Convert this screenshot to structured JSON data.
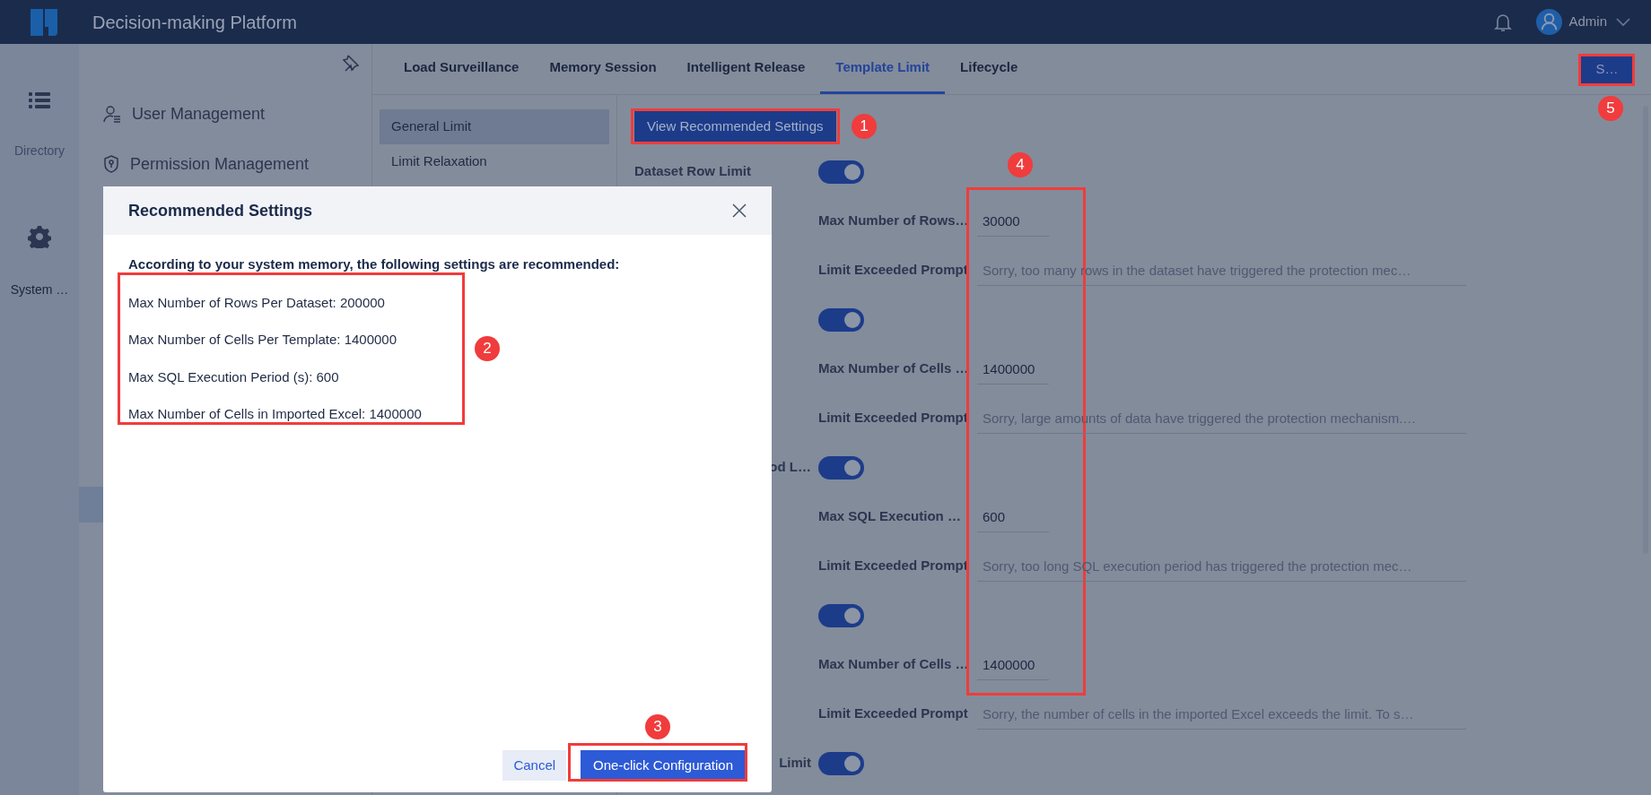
{
  "header": {
    "title": "Decision-making Platform",
    "user": "Admin"
  },
  "rail": [
    {
      "label": "Directory",
      "selected": false
    },
    {
      "label": "System …",
      "selected": true
    }
  ],
  "sidebar": {
    "items": [
      {
        "label": "User Management"
      },
      {
        "label": "Permission Management"
      }
    ]
  },
  "tabs": [
    {
      "label": "Load Surveillance",
      "selected": false
    },
    {
      "label": "Memory Session",
      "selected": false
    },
    {
      "label": "Intelligent Release",
      "selected": false
    },
    {
      "label": "Template Limit",
      "selected": true
    },
    {
      "label": "Lifecycle",
      "selected": false
    }
  ],
  "tab_action": {
    "label": "S…"
  },
  "subnav": [
    {
      "label": "General Limit",
      "selected": true
    },
    {
      "label": "Limit Relaxation",
      "selected": false
    }
  ],
  "view_button": {
    "label": "View Recommended Settings"
  },
  "limits": [
    {
      "label": "Dataset Row Limit",
      "on": true,
      "fields": [
        {
          "kind": "number",
          "label": "Max Number of Rows…",
          "value": "30000"
        },
        {
          "kind": "prompt",
          "label": "Limit Exceeded Prompt",
          "value": "Sorry, too many rows in the dataset have triggered the protection mec…"
        }
      ]
    },
    {
      "on": true,
      "fields": [
        {
          "kind": "number",
          "label": "Max Number of Cells …",
          "value": "1400000"
        },
        {
          "kind": "prompt",
          "label": "Limit Exceeded Prompt",
          "value": "Sorry, large amounts of data have triggered the protection mechanism.…"
        }
      ]
    },
    {
      "label": "od L…",
      "on": true,
      "fields": [
        {
          "kind": "number",
          "label": "Max SQL Execution …",
          "value": "600"
        },
        {
          "kind": "prompt",
          "label": "Limit Exceeded Prompt",
          "value": "Sorry, too long SQL execution period has triggered the protection mec…"
        }
      ]
    },
    {
      "on": true,
      "fields": [
        {
          "kind": "number",
          "label": "Max Number of Cells …",
          "value": "1400000"
        },
        {
          "kind": "prompt",
          "label": "Limit Exceeded Prompt",
          "value": "Sorry, the number of cells in the imported Excel exceeds the limit. To s…"
        }
      ]
    },
    {
      "label": "Limit",
      "on": true
    }
  ],
  "dialog": {
    "title": "Recommended Settings",
    "intro": "According to your system memory, the following settings are recommended:",
    "items": [
      "Max Number of Rows Per Dataset: 200000",
      "Max Number of Cells Per Template: 1400000",
      "Max SQL Execution Period (s): 600",
      "Max Number of Cells in Imported Excel: 1400000"
    ],
    "buttons": [
      {
        "kind": "secondary",
        "label": "Cancel"
      },
      {
        "kind": "primary",
        "label": "One-click Configuration"
      }
    ]
  },
  "annotations": [
    {
      "label": "1"
    },
    {
      "label": "2"
    },
    {
      "label": "3"
    },
    {
      "label": "4"
    },
    {
      "label": "5"
    }
  ]
}
